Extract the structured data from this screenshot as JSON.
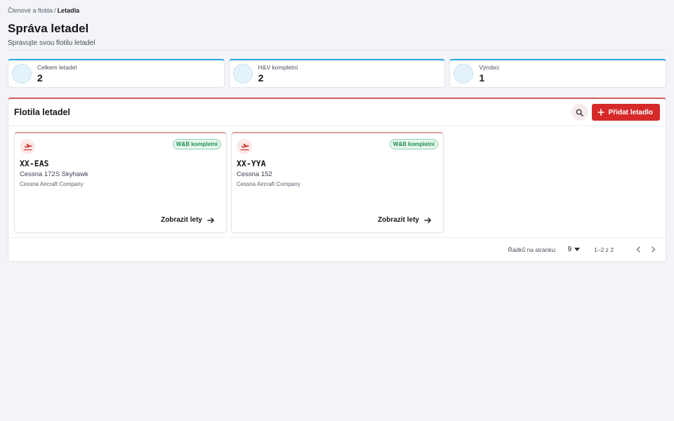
{
  "breadcrumb": {
    "parent": "Členové a flotila",
    "separator": "/",
    "current": "Letadla"
  },
  "page": {
    "title": "Správa letadel",
    "subtitle": "Spravujte svou flotilu letadel"
  },
  "stats": [
    {
      "label": "Celkem letadel",
      "value": "2"
    },
    {
      "label": "H&V kompletní",
      "value": "2"
    },
    {
      "label": "Výrobci",
      "value": "1"
    }
  ],
  "fleet": {
    "title": "Flotila letadel",
    "add_label": "Přidat letadlo",
    "aircraft": [
      {
        "registration": "XX-EAS",
        "model": "Cessna 172S Skyhawk",
        "manufacturer": "Cessna Aircraft Company",
        "badge": "W&B kompletní",
        "link": "Zobrazit lety"
      },
      {
        "registration": "XX-YYA",
        "model": "Cessna 152",
        "manufacturer": "Cessna Aircraft Company",
        "badge": "W&B kompletní",
        "link": "Zobrazit lety"
      }
    ]
  },
  "pagination": {
    "rows_label": "Řádků na stránku:",
    "rows_value": "9",
    "range": "1–2 z 2"
  },
  "colors": {
    "accent": "#d62a2a",
    "stat_accent": "#29a3e0",
    "success": "#1d8f53"
  },
  "icons": [
    "search-icon",
    "plus-icon",
    "airplane-icon",
    "arrow-right-icon",
    "caret-down-icon",
    "chevron-left-icon",
    "chevron-right-icon"
  ]
}
